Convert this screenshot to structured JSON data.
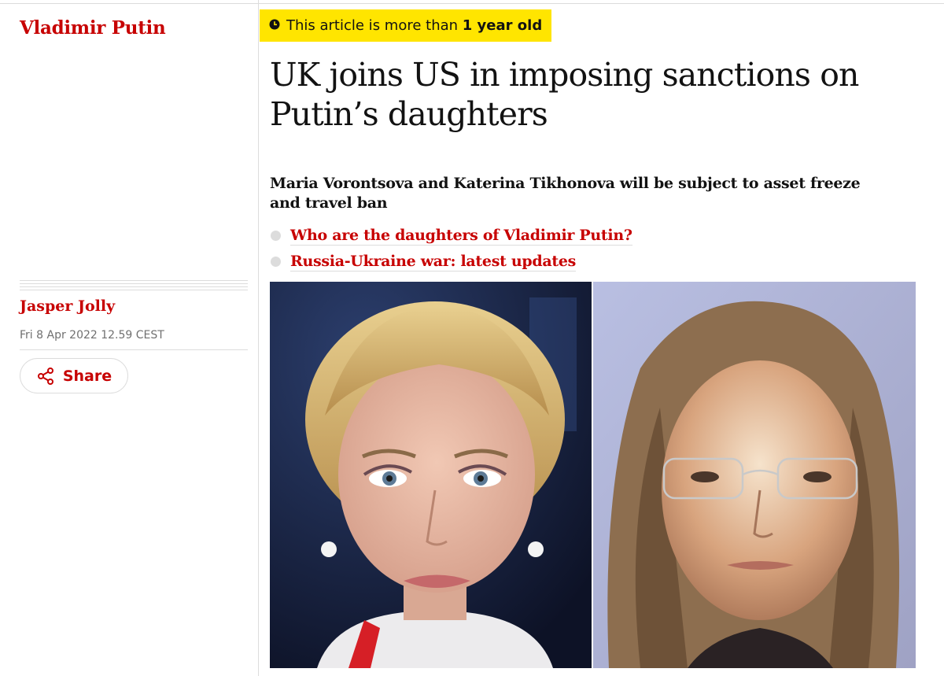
{
  "sidebar": {
    "section_title": "Vladimir Putin",
    "author": "Jasper Jolly",
    "date": "Fri 8 Apr 2022 12.59 CEST",
    "share_label": "Share",
    "share_icon": "share-icon"
  },
  "article": {
    "age_notice_prefix": "This article is more than ",
    "age_notice_strong": "1 year old",
    "age_icon": "clock-icon",
    "headline": "UK joins US in imposing sanctions on Putin’s daughters",
    "standfirst": "Maria Vorontsova and Katerina Tikhonova will be subject to asset freeze and travel ban",
    "related_links": [
      "Who are the daughters of Vladimir Putin?",
      "Russia-Ukraine war: latest updates"
    ]
  },
  "colors": {
    "accent_red": "#c70000",
    "age_badge_yellow": "#ffe500",
    "rule_gray": "#dcdcdc"
  }
}
